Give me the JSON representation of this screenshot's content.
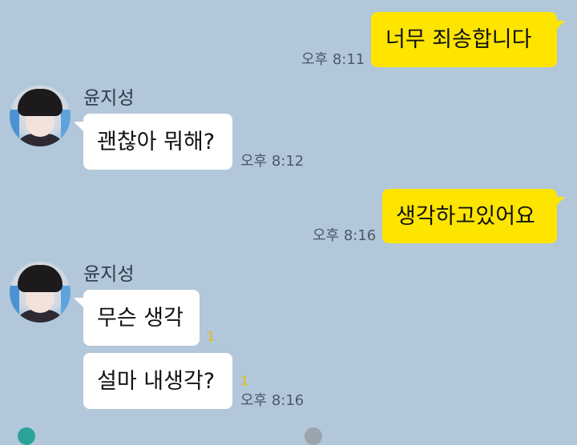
{
  "messages": [
    {
      "sender_type": "me",
      "text": "너무 죄송합니다",
      "time": "오후 8:11"
    },
    {
      "sender_type": "other",
      "sender_name": "윤지성",
      "text": "괜찮아 뭐해?",
      "time": "오후 8:12"
    },
    {
      "sender_type": "me",
      "text": "생각하고있어요",
      "time": "오후 8:16"
    },
    {
      "sender_type": "other",
      "sender_name": "윤지성",
      "text": "무슨 생각",
      "unread": "1"
    },
    {
      "sender_type": "other",
      "text": "설마 내생각?",
      "unread": "1",
      "time": "오후 8:16"
    }
  ],
  "colors": {
    "background": "#b2c7d9",
    "my_bubble": "#fee500",
    "other_bubble": "#ffffff",
    "unread_count": "#e0c000"
  }
}
